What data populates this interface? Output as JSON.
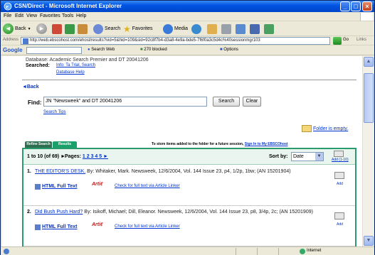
{
  "window": {
    "title": "CSN/Direct - Microsoft Internet Explorer",
    "buttons": {
      "min": "_",
      "max": "□",
      "close": "×"
    }
  },
  "menu": [
    "File",
    "Edit",
    "View",
    "Favorites",
    "Tools",
    "Help"
  ],
  "toolbar": {
    "back": "Back",
    "search": "Search",
    "favorites": "Favorites",
    "media": "Media"
  },
  "address": {
    "label": "Address",
    "url": "http://web.ebscohost.com/ehost/results?vid=5&hid=109&sid=92c8f7b4-d3a8-4e9a-bde5-7f6f0a3c5d4c%40sessionmgr103",
    "go": "Go",
    "links": "Links"
  },
  "googlebar": {
    "logo": "Google",
    "search_web": "Search Web",
    "blocked": "270 blocked",
    "options": "Options"
  },
  "content": {
    "top_partial": "Database: Academic Search Premier   and DT 20041206",
    "searched_label": "Searched:",
    "searched_link": "Info: Ta Trial, Search",
    "db_help": "Database Help",
    "back_link": "◄Back",
    "find_label": "Find:",
    "find_value": "JN \"Newsweek\" and DT 20041206",
    "search_btn": "Search",
    "clear_btn": "Clear",
    "search_tips": "Search Tips",
    "folder_empty": "Folder is empty.",
    "tab_refine": "Refine Search",
    "tab_results": "Results",
    "folder_note": "To store items added to the folder for a future session,",
    "folder_note_link": "Sign In to My EBSCOhost",
    "range": "1 to 10 (of 69) ►",
    "pages_label": "Pages:",
    "pages": "1 2 3 4 5 ►",
    "sort_label": "Sort by:",
    "sort_value": "Date",
    "add_all": "Add (1-10)"
  },
  "results": [
    {
      "num": "1.",
      "title": "THE EDITOR'S DESK.",
      "meta": " By: Whitaker, Mark. Newsweek, 12/6/2004, Vol. 144 Issue 23, p4, 1/2p, 1bw; (AN 15201904)",
      "html": "HTML Full Text",
      "check": "Check for full text via Article Linker",
      "add": "Add"
    },
    {
      "num": "2.",
      "title": "Did Bush Push Hard?",
      "meta": " By: Isikoff, Michael; Dill, Eleanor. Newsweek, 12/6/2004, Vol. 144 Issue 23, p8, 3/4p, 2c; (AN 15201909)",
      "html": "HTML Full Text",
      "check": "Check for full text via Article Linker",
      "add": "Add"
    }
  ],
  "status": {
    "zone": "Internet"
  }
}
